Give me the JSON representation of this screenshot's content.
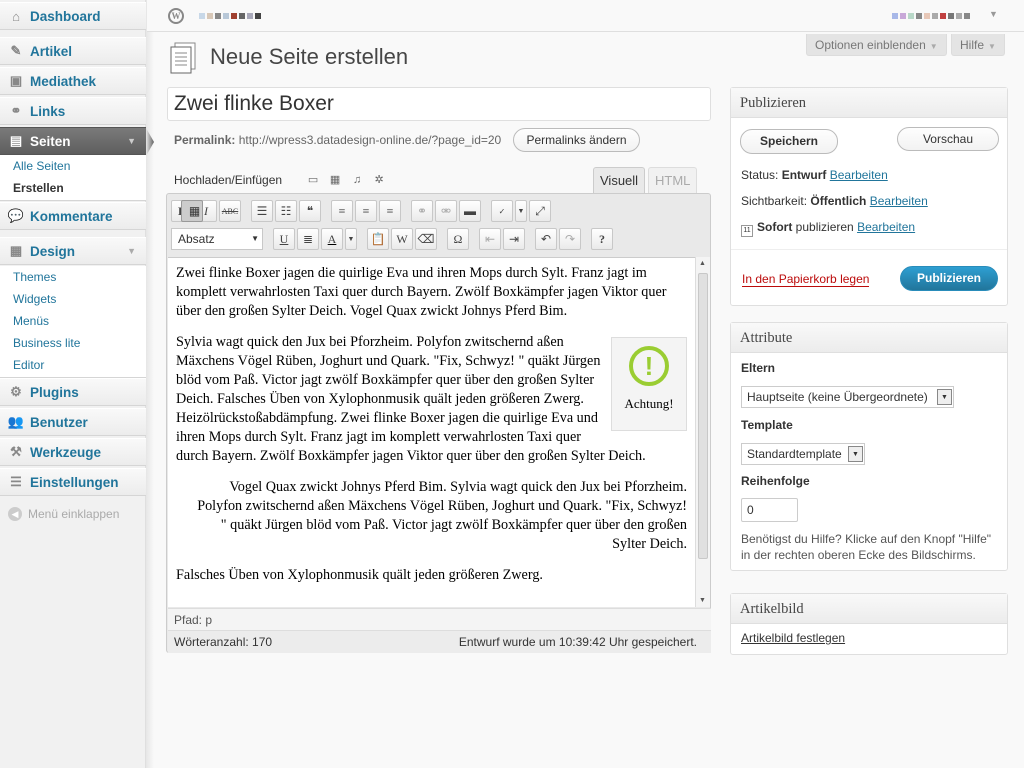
{
  "sidebar": {
    "items": [
      {
        "label": "Dashboard",
        "icon": "dashboard-icon"
      },
      {
        "label": "Artikel",
        "icon": "pin-icon"
      },
      {
        "label": "Mediathek",
        "icon": "media-icon"
      },
      {
        "label": "Links",
        "icon": "links-icon"
      },
      {
        "label": "Seiten",
        "icon": "pages-icon"
      },
      {
        "label": "Kommentare",
        "icon": "comments-icon"
      },
      {
        "label": "Design",
        "icon": "appearance-icon"
      },
      {
        "label": "Plugins",
        "icon": "plugins-icon"
      },
      {
        "label": "Benutzer",
        "icon": "users-icon"
      },
      {
        "label": "Werkzeuge",
        "icon": "tools-icon"
      },
      {
        "label": "Einstellungen",
        "icon": "settings-icon"
      }
    ],
    "pages_sub": [
      "Alle Seiten",
      "Erstellen"
    ],
    "design_sub": [
      "Themes",
      "Widgets",
      "Menüs",
      "Business lite",
      "Editor"
    ],
    "collapse": "Menü einklappen"
  },
  "header": {
    "options_label": "Optionen einblenden",
    "help_label": "Hilfe"
  },
  "page": {
    "title": "Neue Seite erstellen",
    "post_title": "Zwei flinke Boxer",
    "permalink_label": "Permalink:",
    "permalink_url": "http://wpress3.datadesign-online.de/?page_id=20",
    "permalink_button": "Permalinks ändern"
  },
  "editor": {
    "upload_label": "Hochladen/Einfügen",
    "tab_visual": "Visuell",
    "tab_html": "HTML",
    "format_select": "Absatz",
    "paragraphs": [
      "Zwei flinke Boxer jagen die quirlige Eva und ihren Mops durch Sylt. Franz jagt im komplett verwahrlosten Taxi quer durch Bayern. Zwölf Boxkämpfer jagen Viktor quer über den großen Sylter Deich. Vogel Quax zwickt Johnys Pferd Bim.",
      "Sylvia wagt quick den Jux bei Pforzheim. Polyfon zwitschernd aßen Mäxchens Vögel Rüben, Joghurt und Quark. \"Fix, Schwyz! \" quäkt Jürgen blöd vom Paß. Victor jagt zwölf Boxkämpfer quer über den großen Sylter Deich. Falsches Üben von Xylophonmusik quält jeden größeren Zwerg. Heizölrückstoßabdämpfung. Zwei flinke Boxer jagen die quirlige Eva und ihren Mops durch Sylt. Franz jagt im komplett verwahrlosten Taxi quer durch Bayern. Zwölf Boxkämpfer jagen Viktor quer über den großen Sylter Deich.",
      "Vogel Quax zwickt Johnys Pferd Bim. Sylvia wagt quick den Jux bei Pforzheim. Polyfon zwitschernd aßen Mäxchens Vögel Rüben, Joghurt und Quark. \"Fix, Schwyz! \" quäkt Jürgen blöd vom Paß. Victor jagt zwölf Boxkämpfer quer über den großen Sylter Deich.",
      "Falsches Üben von Xylophonmusik quält jeden größeren Zwerg."
    ],
    "image_caption": "Achtung!",
    "path": "Pfad: p",
    "word_count": "Wörteranzahl: 170",
    "draft_saved": "Entwurf wurde um 10:39:42 Uhr gespeichert."
  },
  "publish": {
    "heading": "Publizieren",
    "save": "Speichern",
    "preview": "Vorschau",
    "status_label": "Status:",
    "status_value": "Entwurf",
    "visibility_label": "Sichtbarkeit:",
    "visibility_value": "Öffentlich",
    "schedule_value": "Sofort",
    "schedule_suffix": "publizieren",
    "edit": "Bearbeiten",
    "trash": "In den Papierkorb legen",
    "publish": "Publizieren"
  },
  "attributes": {
    "heading": "Attribute",
    "parent_label": "Eltern",
    "parent_value": "Hauptseite (keine Übergeordnete)",
    "template_label": "Template",
    "template_value": "Standardtemplate",
    "order_label": "Reihenfolge",
    "order_value": "0",
    "help_text": "Benötigst du Hilfe? Klicke auf den Knopf \"Hilfe\" in der rechten oberen Ecke des Bildschirms."
  },
  "featured": {
    "heading": "Artikelbild",
    "link": "Artikelbild festlegen"
  },
  "colors": {
    "link": "#21759b",
    "active_menu": "#6d6d6d",
    "publish_button": "#21759b",
    "trash": "#bc0b0b"
  }
}
